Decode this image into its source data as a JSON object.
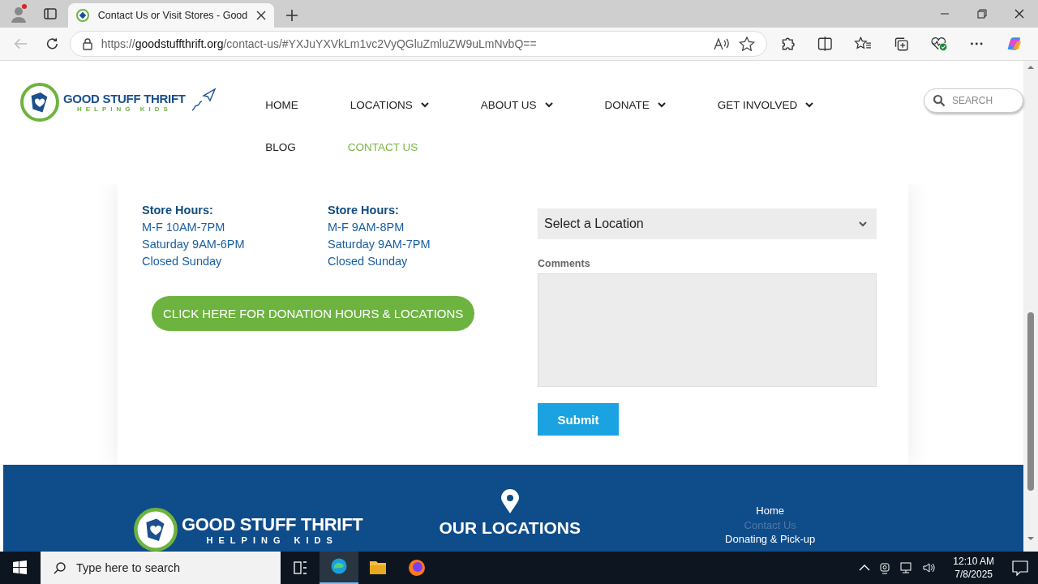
{
  "browser": {
    "tab_title": "Contact Us or Visit Stores - Good",
    "url": "https://**goodstuffthrift.org**/contact-us/#YXJuYXVkLm1vc2VyQGluZmluZW9uLmNvbQ=="
  },
  "header": {
    "logo_title": "GOOD STUFF THRIFT",
    "logo_tagline": "HELPING KIDS",
    "nav": [
      {
        "label": "HOME",
        "dropdown": false,
        "selected": false
      },
      {
        "label": "LOCATIONS",
        "dropdown": true,
        "selected": false
      },
      {
        "label": "ABOUT US",
        "dropdown": true,
        "selected": false
      },
      {
        "label": "DONATE",
        "dropdown": true,
        "selected": false
      },
      {
        "label": "GET INVOLVED",
        "dropdown": true,
        "selected": false
      },
      {
        "label": "BLOG",
        "dropdown": false,
        "selected": false
      },
      {
        "label": "CONTACT US",
        "dropdown": false,
        "selected": true
      }
    ],
    "search": {
      "placeholder": "SEARCH"
    }
  },
  "stores": [
    {
      "hours_title": "Store Hours:",
      "lines": [
        "M-F 10AM-7PM",
        "Saturday 9AM-6PM",
        "Closed Sunday"
      ]
    },
    {
      "hours_title": "Store Hours:",
      "lines": [
        "M-F 9AM-8PM",
        "Saturday 9AM-7PM",
        "Closed Sunday"
      ]
    }
  ],
  "donation_button": "CLICK HERE FOR DONATION HOURS & LOCATIONS",
  "form": {
    "location_select": "Select a Location",
    "comments_label": "Comments",
    "submit": "Submit"
  },
  "footer": {
    "logo_title": "GOOD STUFF THRIFT",
    "logo_tagline": "HELPING KIDS",
    "locations_title": "OUR LOCATIONS",
    "links": [
      {
        "label": "Home",
        "selected": false
      },
      {
        "label": "Contact Us",
        "selected": true
      },
      {
        "label": "Donating & Pick-up",
        "selected": false
      }
    ]
  },
  "taskbar": {
    "search_placeholder": "Type here to search",
    "time": "12:10 AM",
    "date": "7/8/2025"
  }
}
